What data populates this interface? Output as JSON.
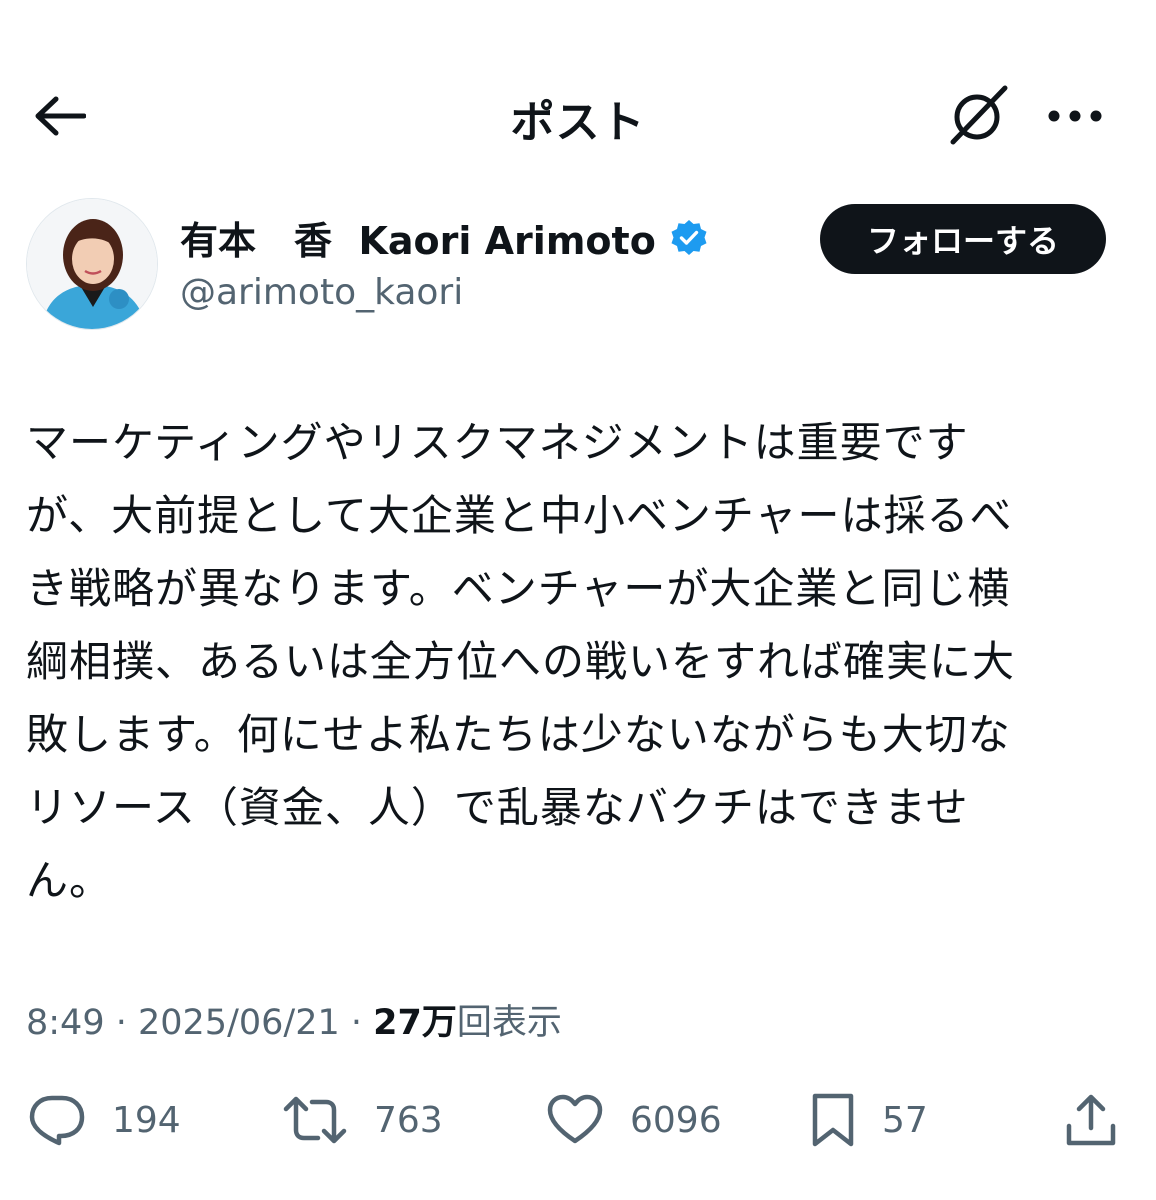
{
  "header": {
    "title": "ポスト",
    "back_icon": "arrow-left-icon",
    "grok_icon": "grok-icon",
    "more_icon": "more-icon"
  },
  "author": {
    "display_name": "有本　香  Kaori Arimoto",
    "handle": "@arimoto_kaori",
    "verified_color": "#1d9bf0",
    "follow_label": "フォローする"
  },
  "tweet": {
    "lines": [
      "マーケティングやリスクマネジメントは重要です",
      "が、大前提として大企業と中小ベンチャーは採るべ",
      "き戦略が異なります。ベンチャーが大企業と同じ横",
      "綱相撲、あるいは全方位への戦いをすれば確実に大",
      "敗します。何にせよ私たちは少ないながらも大切な",
      "リソース（資金、人）で乱暴なバクチはできませ",
      "ん。"
    ]
  },
  "meta": {
    "time": "8:49",
    "sep1": " · ",
    "date": "2025/06/21",
    "sep2": " · ",
    "views_count": "27万",
    "views_label": "回表示"
  },
  "actions": {
    "reply": {
      "icon": "reply-icon",
      "count": "194"
    },
    "repost": {
      "icon": "repost-icon",
      "count": "763"
    },
    "like": {
      "icon": "heart-icon",
      "count": "6096"
    },
    "bookmark": {
      "icon": "bookmark-icon",
      "count": "57"
    },
    "share": {
      "icon": "share-icon"
    }
  }
}
